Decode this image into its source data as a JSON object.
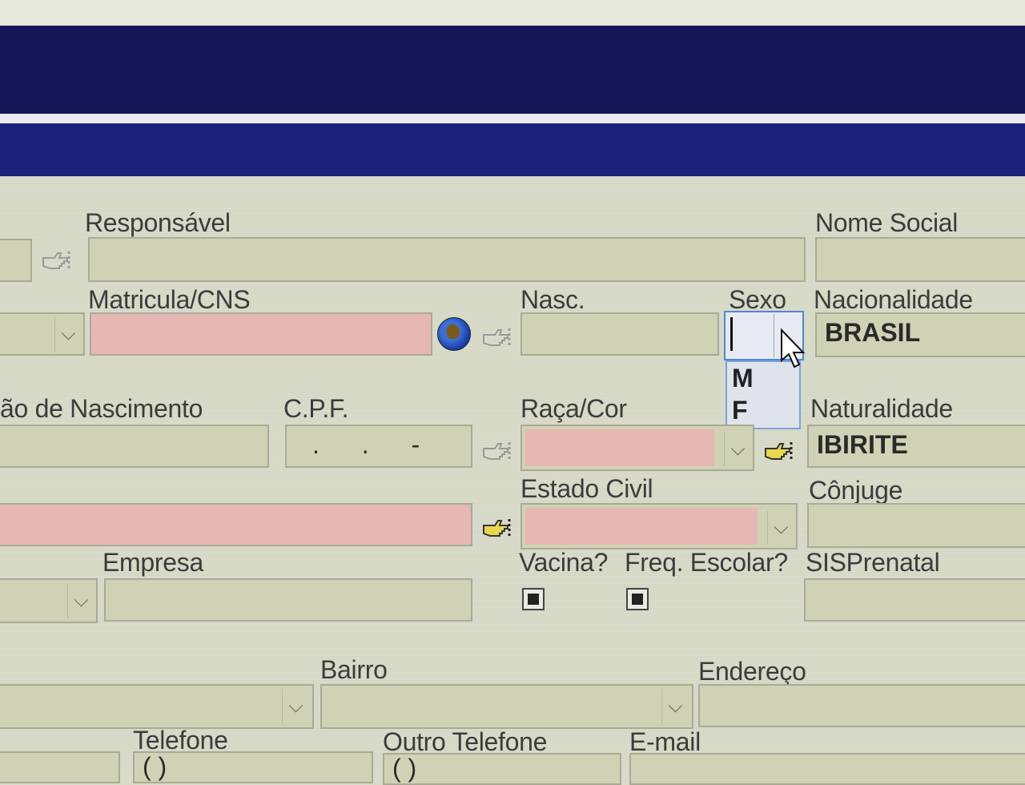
{
  "labels": {
    "responsavel": "Responsável",
    "nome_social": "Nome Social",
    "matricula": "Matricula/CNS",
    "nasc": "Nasc.",
    "sexo": "Sexo",
    "nacionalidade": "Nacionalidade",
    "local_nascimento": "ão de Nascimento",
    "cpf": "C.P.F.",
    "raca_cor": "Raça/Cor",
    "naturalidade": "Naturalidade",
    "estado_civil": "Estado Civil",
    "conjuge": "Cônjuge",
    "empresa": "Empresa",
    "vacina": "Vacina?",
    "freq_escolar": "Freq. Escolar?",
    "sisprenatal": "SISPrenatal",
    "bairro": "Bairro",
    "endereco": "Endereço",
    "telefone": "Telefone",
    "outro_telefone": "Outro Telefone",
    "email": "E-mail"
  },
  "values": {
    "nacionalidade": "BRASIL",
    "naturalidade": "IBIRITE",
    "cpf": ". . -",
    "telefone": "( )",
    "outro_telefone": "( )"
  },
  "sexo_dropdown": {
    "options": [
      "M",
      "F"
    ]
  },
  "checkboxes": {
    "vacina": true,
    "freq_escolar": true
  },
  "colors": {
    "title_band_dark": "#151657",
    "title_band": "#1a207a",
    "field": "#cfd2b4",
    "required_field": "#e7b7b3",
    "background": "#d6d8c6"
  }
}
